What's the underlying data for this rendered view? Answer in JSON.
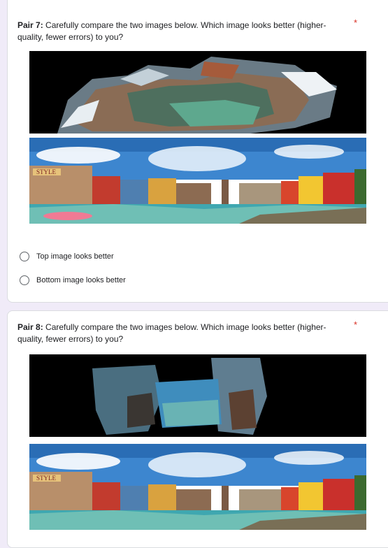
{
  "pair7": {
    "label": "Pair 7:",
    "question": " Carefully compare the two images below. Which image looks better (higher-quality, fewer errors) to you?",
    "required_mark": "*",
    "options": [
      "Top image looks better",
      "Bottom image looks better"
    ]
  },
  "pair8": {
    "label": "Pair 8:",
    "question": " Carefully compare the two images below. Which image looks better (higher-quality, fewer errors) to you?",
    "required_mark": "*"
  },
  "style_sign": "STYLE",
  "colors": {
    "background": "#f0ebf8",
    "card": "#ffffff",
    "required": "#d93025",
    "text": "#202124",
    "radio_border": "#5f6368"
  }
}
